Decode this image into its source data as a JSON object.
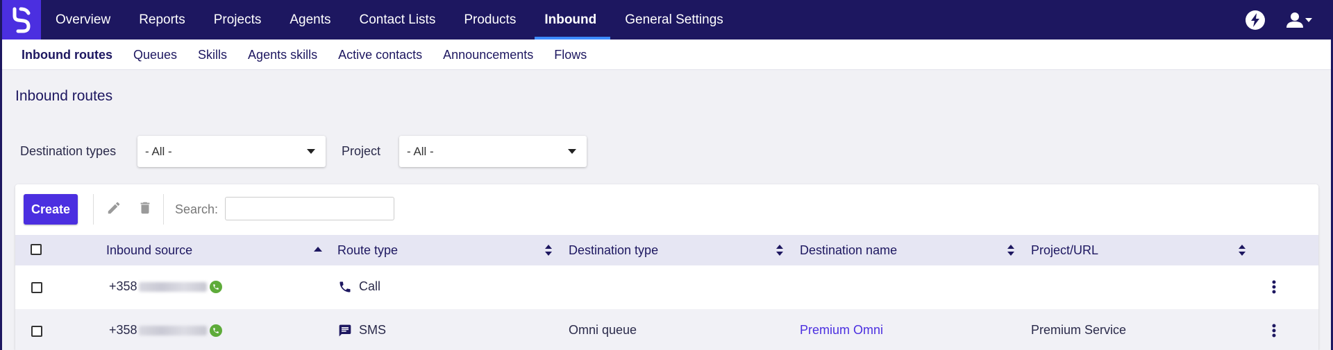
{
  "nav": {
    "items": [
      {
        "label": "Overview"
      },
      {
        "label": "Reports"
      },
      {
        "label": "Projects"
      },
      {
        "label": "Agents"
      },
      {
        "label": "Contact Lists"
      },
      {
        "label": "Products"
      },
      {
        "label": "Inbound",
        "active": true
      },
      {
        "label": "General Settings"
      }
    ],
    "right_icons": [
      "bolt-icon",
      "user-icon"
    ]
  },
  "subnav": {
    "items": [
      {
        "label": "Inbound routes",
        "active": true
      },
      {
        "label": "Queues"
      },
      {
        "label": "Skills"
      },
      {
        "label": "Agents skills"
      },
      {
        "label": "Active contacts"
      },
      {
        "label": "Announcements"
      },
      {
        "label": "Flows"
      }
    ]
  },
  "page": {
    "title": "Inbound routes"
  },
  "filters": {
    "destination_types": {
      "label": "Destination types",
      "value": "- All -"
    },
    "project": {
      "label": "Project",
      "value": "- All -"
    }
  },
  "toolbar": {
    "create_label": "Create",
    "search_label": "Search:",
    "search_value": ""
  },
  "table": {
    "headers": [
      "Inbound source",
      "Route type",
      "Destination type",
      "Destination name",
      "Project/URL"
    ],
    "rows": [
      {
        "source_prefix": "+358",
        "route_icon": "phone-icon",
        "route_type": "Call",
        "destination_type": "",
        "destination_name": "",
        "project": ""
      },
      {
        "source_prefix": "+358",
        "route_icon": "sms-icon",
        "route_type": "SMS",
        "destination_type": "Omni queue",
        "destination_name": "Premium Omni",
        "project": "Premium Service"
      }
    ]
  },
  "colors": {
    "nav_bg": "#1d1760",
    "accent": "#4b2fe0",
    "active_underline": "#3d8bff",
    "table_header_bg": "#e6e6f3",
    "page_bg": "#f1f1f5"
  }
}
